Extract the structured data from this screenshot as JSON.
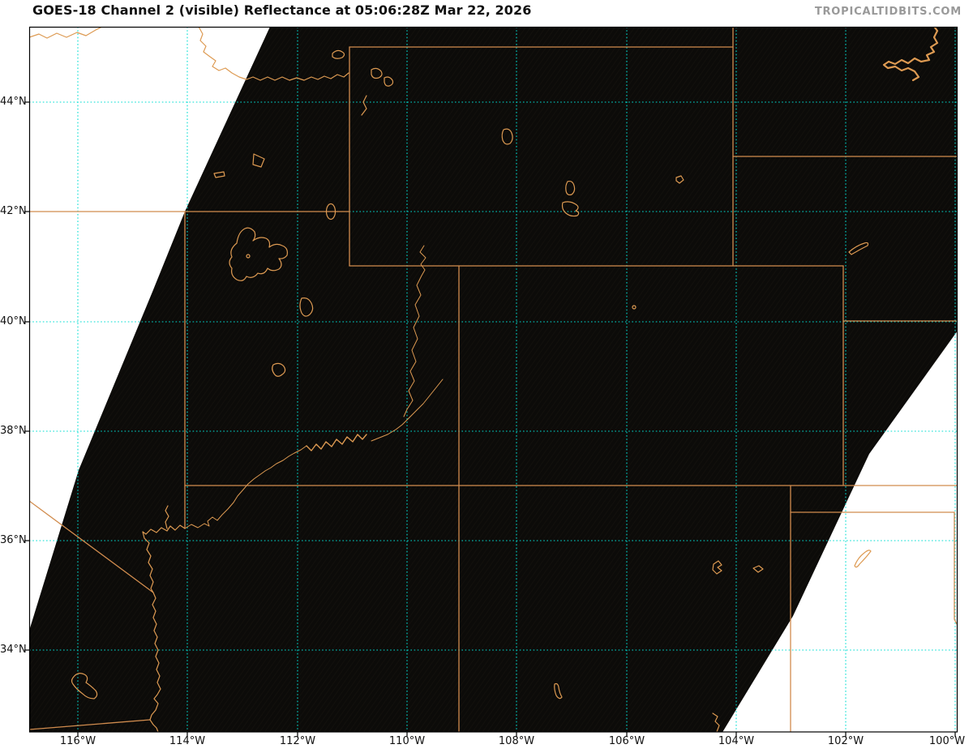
{
  "header": {
    "title": "GOES-18 Channel 2 (visible) Reflectance at 05:06:28Z Mar 22, 2026",
    "watermark": "TROPICALTIDBITS.COM"
  },
  "axes": {
    "x_labels": [
      "116°W",
      "114°W",
      "112°W",
      "110°W",
      "108°W",
      "106°W",
      "104°W",
      "102°W",
      "100°W"
    ],
    "y_labels": [
      "44°N",
      "42°N",
      "40°N",
      "38°N",
      "36°N",
      "34°N"
    ]
  },
  "colors": {
    "state_border": "#d18c4e",
    "water_feature": "#dd9a52",
    "graticule": "#00ded2",
    "map_background": "#0c0b09",
    "scan_gap": "#ffffff",
    "axis_spine": "#000000",
    "title_text": "#111111",
    "watermark_text": "#999999"
  }
}
